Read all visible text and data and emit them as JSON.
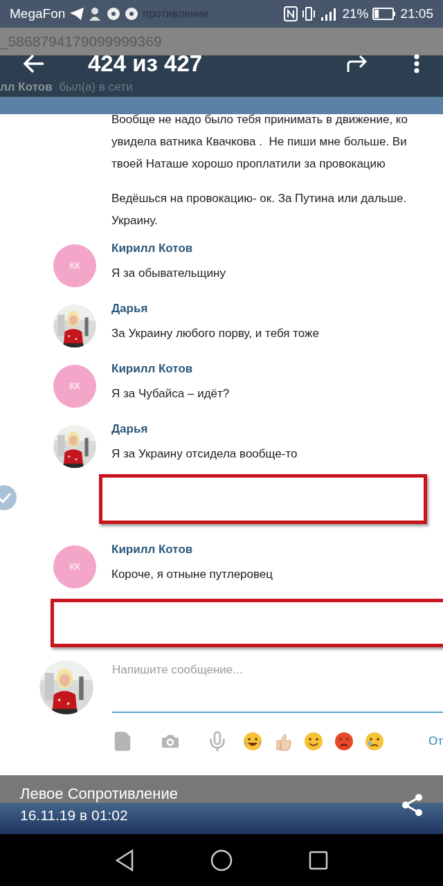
{
  "status_bar": {
    "carrier": "MegaFon",
    "tab_title": "противление",
    "battery": "21%",
    "time": "21:05"
  },
  "address_bar": {
    "url": "_5868794179099999369"
  },
  "viewer_toolbar": {
    "counter": "424 из 427"
  },
  "chat_header": {
    "name": "лл Котов",
    "status": "был(а) в сети"
  },
  "messages": [
    {
      "kind": "continuation",
      "paragraphs": [
        "Вообще не надо было тебя принимать в движение, ко\nувидела ватника Квачкова .  Не пиши мне больше. Ви\nтвоей Наташе хорошо проплатили за провокацию",
        "Ведёшься на провокацию- ок. За Путина или дальше.\nУкраину."
      ]
    },
    {
      "kind": "message",
      "author": "Кирилл Котов",
      "avatar": {
        "kind": "initials",
        "initials": "КК"
      },
      "text": "Я за обывательщину"
    },
    {
      "kind": "message",
      "author": "Дарья",
      "text": "За Украину любого порву, и тебя тоже"
    },
    {
      "kind": "message",
      "author": "Кирилл Котов",
      "avatar": {
        "kind": "initials",
        "initials": "КК"
      },
      "text": "Я за Чубайса – идёт?"
    },
    {
      "kind": "message",
      "author": "Дарья",
      "text": "Я за Украину отсидела вообще-то"
    },
    {
      "kind": "redacted",
      "checked": true
    },
    {
      "kind": "message",
      "author": "Кирилл Котов",
      "avatar": {
        "kind": "initials",
        "initials": "КК"
      },
      "text": "Короче, я отныне путлеровец"
    },
    {
      "kind": "redacted",
      "checked": false
    }
  ],
  "composer": {
    "placeholder": "Напишите сообщение...",
    "send_label": "От"
  },
  "caption": {
    "title": "Левое Сопротивление",
    "date": "16.11.19 в 01:02"
  }
}
